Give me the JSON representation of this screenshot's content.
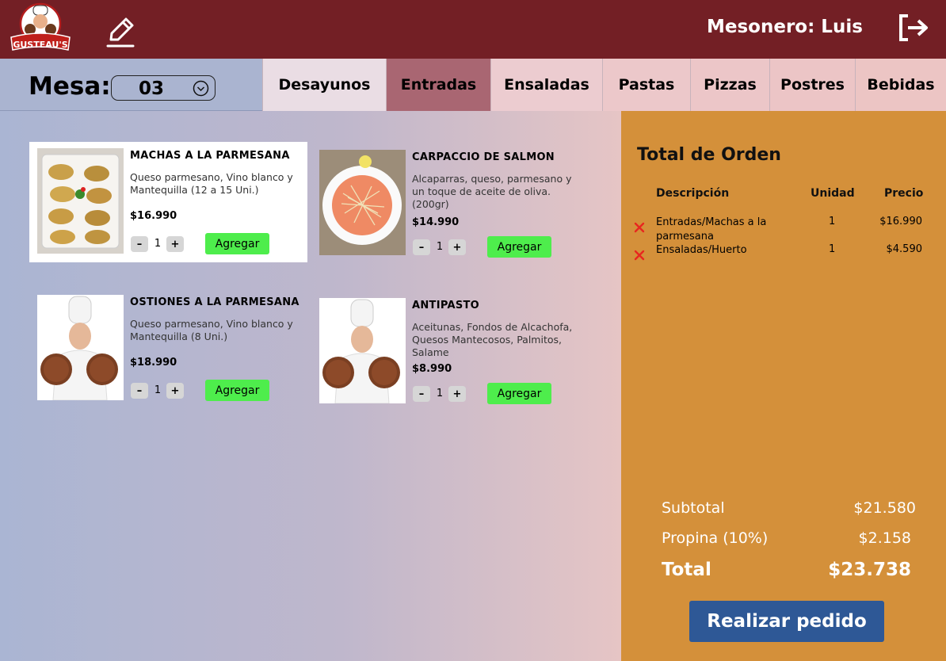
{
  "header": {
    "logo_text": "GUSTEAU'S",
    "waiter": "Mesonero: Luis"
  },
  "table_selector": {
    "label": "Mesa:",
    "value": "03"
  },
  "tabs": [
    {
      "label": "Desayunos"
    },
    {
      "label": "Entradas",
      "active": true
    },
    {
      "label": "Ensaladas"
    },
    {
      "label": "Pastas"
    },
    {
      "label": "Pizzas"
    },
    {
      "label": "Postres"
    },
    {
      "label": "Bebidas"
    }
  ],
  "products": [
    {
      "name": "MACHAS A LA PARMESANA",
      "description": "Queso parmesano, Vino blanco y Mantequilla (12 a 15 Uni.)",
      "price": "$16.990",
      "qty": "1",
      "add_label": "Agregar",
      "image": "oysters-photo",
      "selected": true
    },
    {
      "name": "CARPACCIO DE SALMON",
      "description": "Alcaparras, queso, parmesano y un toque de aceite de oliva. (200gr)",
      "price": "$14.990",
      "qty": "1",
      "add_label": "Agregar",
      "image": "carpaccio-photo"
    },
    {
      "name": "OSTIONES A LA PARMESANA",
      "description": "Queso parmesano, Vino blanco y Mantequilla (8 Uni.)",
      "price": "$18.990",
      "qty": "1",
      "add_label": "Agregar",
      "image": "chef-placeholder"
    },
    {
      "name": "ANTIPASTO",
      "description": "Aceitunas, Fondos de Alcachofa, Quesos Mantecosos, Palmitos, Salame",
      "price": "$8.990",
      "qty": "1",
      "add_label": "Agregar",
      "image": "chef-placeholder"
    }
  ],
  "order": {
    "title": "Total de Orden",
    "columns": {
      "description": "Descripción",
      "unit": "Unidad",
      "price": "Precio"
    },
    "items": [
      {
        "description": "Entradas/Machas a la parmesana",
        "unit": "1",
        "price": "$16.990"
      },
      {
        "description": "Ensaladas/Huerto",
        "unit": "1",
        "price": "$4.590"
      }
    ],
    "subtotal_label": "Subtotal",
    "subtotal": "$21.580",
    "tip_label": "Propina (10%)",
    "tip": "$2.158",
    "total_label": "Total",
    "total": "$23.738",
    "submit_label": "Realizar pedido"
  },
  "colors": {
    "header": "#731f25",
    "order_panel": "#d4903a",
    "add_button": "#4eed4c",
    "submit_button": "#2e5896",
    "active_tab": "#a96672",
    "delete_icon": "#e8261f"
  }
}
